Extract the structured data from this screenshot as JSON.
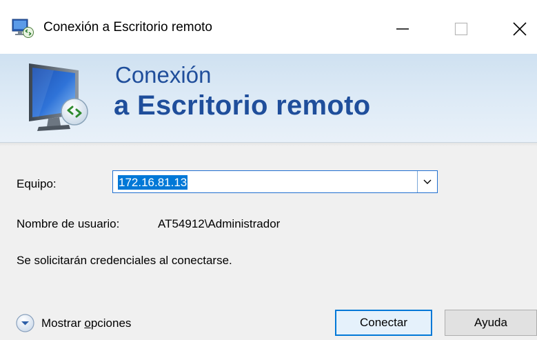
{
  "window": {
    "title": "Conexión a Escritorio remoto",
    "controls": {
      "minimize": "—",
      "maximize": "☐",
      "close": "✕"
    }
  },
  "banner": {
    "line1": "Conexión",
    "line2": "a Escritorio remoto",
    "icon": "remote-desktop-monitor-icon"
  },
  "form": {
    "computer_label": "Equipo:",
    "computer_value": "172.16.81.13",
    "username_label": "Nombre de usuario:",
    "username_value": "AT54912\\Administrador",
    "credentials_note": "Se solicitarán credenciales al conectarse."
  },
  "footer": {
    "options_label_prefix": "Mostrar ",
    "options_label_accel": "o",
    "options_label_suffix": "pciones",
    "connect_label": "Conectar",
    "help_label": "Ayuda"
  },
  "colors": {
    "accent": "#0078d7",
    "banner_text": "#1f4e9b"
  }
}
